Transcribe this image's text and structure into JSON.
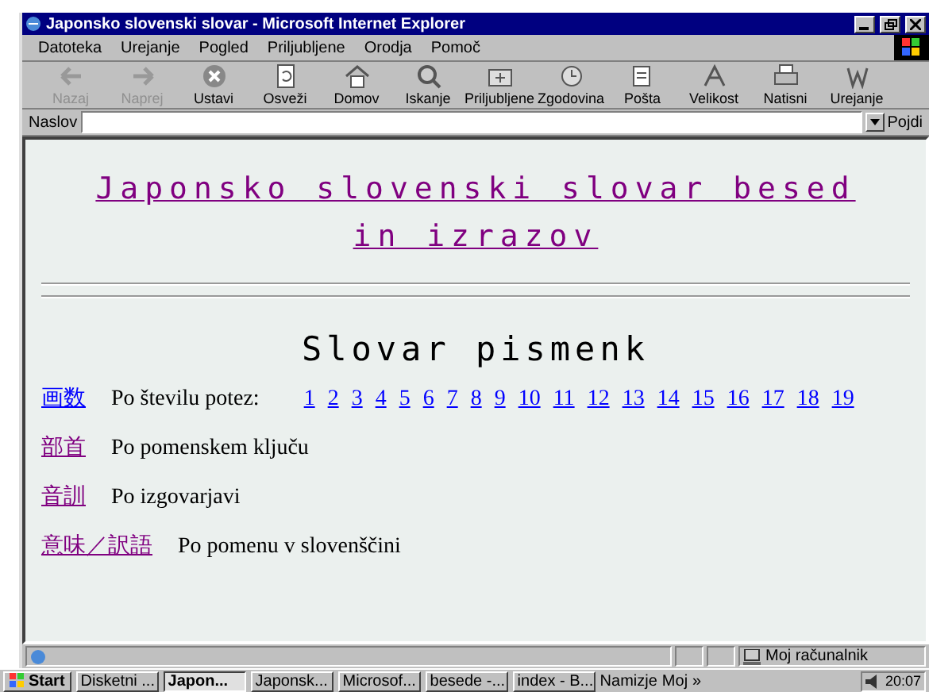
{
  "window": {
    "title": "Japonsko slovenski slovar - Microsoft Internet Explorer"
  },
  "menu": [
    "Datoteka",
    "Urejanje",
    "Pogled",
    "Priljubljene",
    "Orodja",
    "Pomoč"
  ],
  "toolbar": [
    {
      "label": "Nazaj",
      "disabled": true,
      "kind": "back"
    },
    {
      "label": "Naprej",
      "disabled": true,
      "kind": "forward"
    },
    {
      "label": "Ustavi",
      "disabled": false,
      "kind": "stop"
    },
    {
      "label": "Osveži",
      "disabled": false,
      "kind": "refresh"
    },
    {
      "label": "Domov",
      "disabled": false,
      "kind": "home"
    },
    {
      "label": "Iskanje",
      "disabled": false,
      "kind": "search"
    },
    {
      "label": "Priljubljene",
      "disabled": false,
      "kind": "favorites"
    },
    {
      "label": "Zgodovina",
      "disabled": false,
      "kind": "history"
    },
    {
      "label": "Pošta",
      "disabled": false,
      "kind": "mail"
    },
    {
      "label": "Velikost",
      "disabled": false,
      "kind": "font"
    },
    {
      "label": "Natisni",
      "disabled": false,
      "kind": "print"
    },
    {
      "label": "Urejanje",
      "disabled": false,
      "kind": "edit"
    }
  ],
  "address": {
    "label": "Naslov",
    "go": "Pojdi"
  },
  "page": {
    "heading": {
      "text": "Japonsko slovenski slovar besed in izrazov",
      "visited": true
    },
    "subheading": "Slovar pismenk",
    "rows": [
      {
        "link": "画数",
        "visited": false,
        "text": "Po številu potez:",
        "numbers": [
          "1",
          "2",
          "3",
          "4",
          "5",
          "6",
          "7",
          "8",
          "9",
          "10",
          "11",
          "12",
          "13",
          "14",
          "15",
          "16",
          "17",
          "18",
          "19"
        ]
      },
      {
        "link": "部首",
        "visited": true,
        "text": "Po pomenskem ključu"
      },
      {
        "link": "音訓",
        "visited": true,
        "text": "Po izgovarjavi"
      },
      {
        "link": "意味／訳語",
        "visited": true,
        "text": "Po pomenu v slovenščini"
      }
    ]
  },
  "status_bar": {
    "zone": "Moj računalnik"
  },
  "taskbar": {
    "start": "Start",
    "items": [
      {
        "label": "Disketni ...",
        "selected": false
      },
      {
        "label": "Japon...",
        "selected": true
      },
      {
        "label": "Japonsk...",
        "selected": false
      },
      {
        "label": "Microsof...",
        "selected": false
      },
      {
        "label": "besede -...",
        "selected": false
      },
      {
        "label": "index - B...",
        "selected": false
      }
    ],
    "quick": [
      "Namizje",
      "Moj",
      "»"
    ],
    "time": "20:07"
  }
}
